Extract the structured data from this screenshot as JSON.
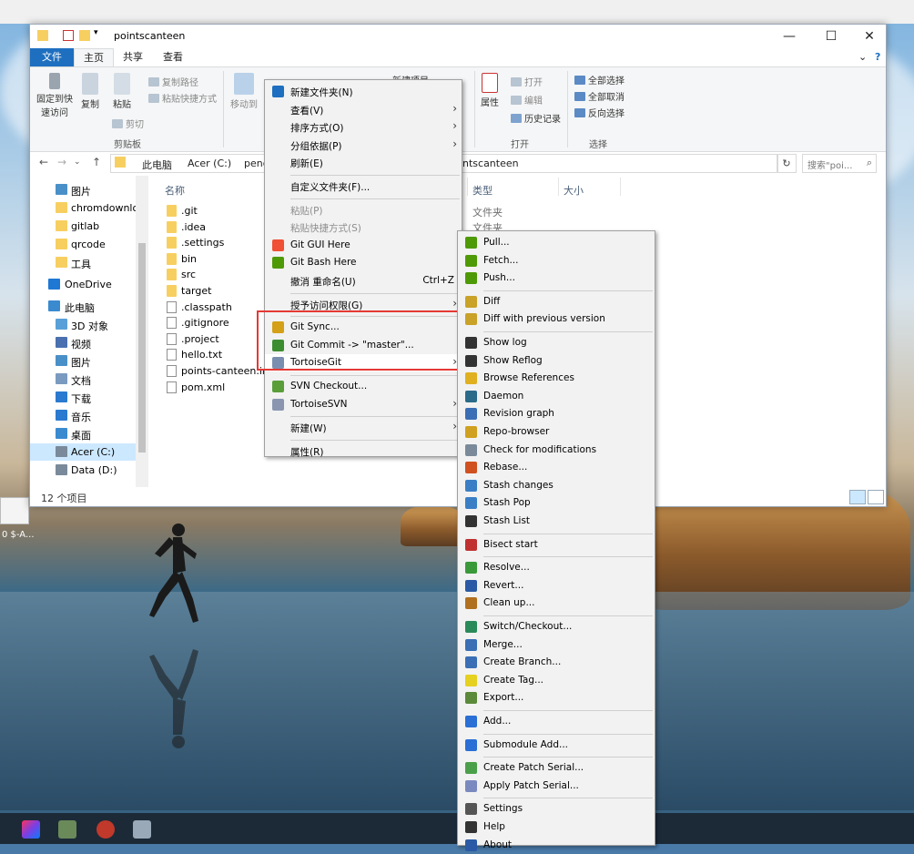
{
  "window": {
    "title": "pointscanteen",
    "controls": {
      "minimize": "—",
      "maximize": "☐",
      "close": "✕",
      "help": "?",
      "expand": "⌄"
    }
  },
  "ribbon_tabs": [
    "文件",
    "主页",
    "共享",
    "查看"
  ],
  "ribbon": {
    "pin_label": "固定到快\n速访问",
    "copy_label": "复制",
    "paste_label": "粘贴",
    "copy_path": "复制路径",
    "paste_shortcut": "粘贴快捷方式",
    "cut": "剪切",
    "clipboard_group": "剪贴板",
    "move_to": "移动到",
    "new_item": "新建项目",
    "properties_label": "属性",
    "open": "打开",
    "edit": "编辑",
    "history": "历史记录",
    "open_group": "打开",
    "select_all": "全部选择",
    "select_none": "全部取消",
    "invert_selection": "反向选择",
    "select_group": "选择"
  },
  "address": {
    "crumbs": [
      "此电脑",
      "Acer (C:)",
      "peng",
      "ntscanteen"
    ],
    "search_placeholder": "搜索\"poi...",
    "nav_back": "←",
    "nav_forward": "→",
    "nav_up": "↑",
    "nav_recent": "⌄",
    "refresh": "↻",
    "search_icon": "⌕"
  },
  "nav_pane": [
    {
      "label": "图片",
      "icon": "pictures-icon"
    },
    {
      "label": "chromdownloa",
      "icon": "folder-icon"
    },
    {
      "label": "gitlab",
      "icon": "folder-icon"
    },
    {
      "label": "qrcode",
      "icon": "folder-icon"
    },
    {
      "label": "工具",
      "icon": "folder-icon"
    },
    {
      "label": "OneDrive",
      "icon": "cloud-icon"
    },
    {
      "label": "此电脑",
      "icon": "pc-icon"
    },
    {
      "label": "3D 对象",
      "icon": "3d-icon"
    },
    {
      "label": "视频",
      "icon": "video-icon"
    },
    {
      "label": "图片",
      "icon": "pictures-icon"
    },
    {
      "label": "文档",
      "icon": "documents-icon"
    },
    {
      "label": "下载",
      "icon": "download-icon"
    },
    {
      "label": "音乐",
      "icon": "music-icon"
    },
    {
      "label": "桌面",
      "icon": "desktop-icon"
    },
    {
      "label": "Acer (C:)",
      "icon": "drive-icon"
    },
    {
      "label": "Data (D:)",
      "icon": "drive-icon"
    }
  ],
  "columns": {
    "name": "名称",
    "type": "类型",
    "size": "大小"
  },
  "files": [
    {
      "name": ".git",
      "kind": "folder"
    },
    {
      "name": ".idea",
      "kind": "folder"
    },
    {
      "name": ".settings",
      "kind": "folder"
    },
    {
      "name": "bin",
      "kind": "folder"
    },
    {
      "name": "src",
      "kind": "folder"
    },
    {
      "name": "target",
      "kind": "folder"
    },
    {
      "name": ".classpath",
      "kind": "doc"
    },
    {
      "name": ".gitignore",
      "kind": "doc"
    },
    {
      "name": ".project",
      "kind": "doc"
    },
    {
      "name": "hello.txt",
      "kind": "doc"
    },
    {
      "name": "points-canteen.iml",
      "kind": "doc"
    },
    {
      "name": "pom.xml",
      "kind": "doc"
    }
  ],
  "type_values": [
    "文件夹",
    "文件夹"
  ],
  "status": {
    "item_count": "12 个项目"
  },
  "context_menu": [
    {
      "label": "新建文件夹(N)",
      "icon": "new-folder-icon"
    },
    {
      "label": "查看(V)",
      "arrow": true
    },
    {
      "label": "排序方式(O)",
      "arrow": true
    },
    {
      "label": "分组依据(P)",
      "arrow": true
    },
    {
      "label": "刷新(E)"
    },
    {
      "sep": true
    },
    {
      "label": "自定义文件夹(F)..."
    },
    {
      "sep": true
    },
    {
      "label": "粘贴(P)",
      "disabled": true
    },
    {
      "label": "粘贴快捷方式(S)",
      "disabled": true
    },
    {
      "label": "Git GUI Here",
      "icon": "git-gui-icon"
    },
    {
      "label": "Git Bash Here",
      "icon": "git-bash-icon"
    },
    {
      "label": "撤消 重命名(U)",
      "shortcut": "Ctrl+Z"
    },
    {
      "sep": true
    },
    {
      "label": "授予访问权限(G)",
      "arrow": true
    },
    {
      "sep": true
    },
    {
      "label": "Git Sync...",
      "icon": "git-sync-icon"
    },
    {
      "label": "Git Commit -> \"master\"...",
      "icon": "git-commit-icon"
    },
    {
      "label": "TortoiseGit",
      "icon": "tortoisegit-icon",
      "arrow": true,
      "highlight": true
    },
    {
      "sep": true
    },
    {
      "label": "SVN Checkout...",
      "icon": "svn-checkout-icon"
    },
    {
      "label": "TortoiseSVN",
      "icon": "tortoisesvn-icon",
      "arrow": true
    },
    {
      "sep": true
    },
    {
      "label": "新建(W)",
      "arrow": true
    },
    {
      "sep": true
    },
    {
      "label": "属性(R)"
    }
  ],
  "tortoise_menu": [
    {
      "label": "Pull...",
      "icon": "pull-icon"
    },
    {
      "label": "Fetch...",
      "icon": "fetch-icon"
    },
    {
      "label": "Push...",
      "icon": "push-icon"
    },
    {
      "sep": true
    },
    {
      "label": "Diff",
      "icon": "diff-icon"
    },
    {
      "label": "Diff with previous version",
      "icon": "diff-previous-icon"
    },
    {
      "sep": true
    },
    {
      "label": "Show log",
      "icon": "show-log-icon"
    },
    {
      "label": "Show Reflog",
      "icon": "show-reflog-icon"
    },
    {
      "label": "Browse References",
      "icon": "browse-references-icon"
    },
    {
      "label": "Daemon",
      "icon": "daemon-icon"
    },
    {
      "label": "Revision graph",
      "icon": "revision-graph-icon"
    },
    {
      "label": "Repo-browser",
      "icon": "repo-browser-icon"
    },
    {
      "label": "Check for modifications",
      "icon": "check-modifications-icon"
    },
    {
      "label": "Rebase...",
      "icon": "rebase-icon"
    },
    {
      "label": "Stash changes",
      "icon": "stash-changes-icon"
    },
    {
      "label": "Stash Pop",
      "icon": "stash-pop-icon"
    },
    {
      "label": "Stash List",
      "icon": "stash-list-icon"
    },
    {
      "sep": true
    },
    {
      "label": "Bisect start",
      "icon": "bisect-icon"
    },
    {
      "sep": true
    },
    {
      "label": "Resolve...",
      "icon": "resolve-icon"
    },
    {
      "label": "Revert...",
      "icon": "revert-icon"
    },
    {
      "label": "Clean up...",
      "icon": "cleanup-icon"
    },
    {
      "sep": true
    },
    {
      "label": "Switch/Checkout...",
      "icon": "switch-icon"
    },
    {
      "label": "Merge...",
      "icon": "merge-icon"
    },
    {
      "label": "Create Branch...",
      "icon": "branch-icon"
    },
    {
      "label": "Create Tag...",
      "icon": "tag-icon"
    },
    {
      "label": "Export...",
      "icon": "export-icon"
    },
    {
      "sep": true
    },
    {
      "label": "Add...",
      "icon": "add-icon"
    },
    {
      "sep": true
    },
    {
      "label": "Submodule Add...",
      "icon": "submodule-add-icon"
    },
    {
      "sep": true
    },
    {
      "label": "Create Patch Serial...",
      "icon": "create-patch-icon"
    },
    {
      "label": "Apply Patch Serial...",
      "icon": "apply-patch-icon"
    },
    {
      "sep": true
    },
    {
      "label": "Settings",
      "icon": "settings-icon"
    },
    {
      "label": "Help",
      "icon": "help-icon"
    },
    {
      "label": "About",
      "icon": "about-icon"
    }
  ],
  "desktop": {
    "snippet_label": "0 $-A..."
  },
  "colors": {
    "accent": "#1e6fbf",
    "highlight_box": "#e53935",
    "folder": "#f7cf61"
  }
}
